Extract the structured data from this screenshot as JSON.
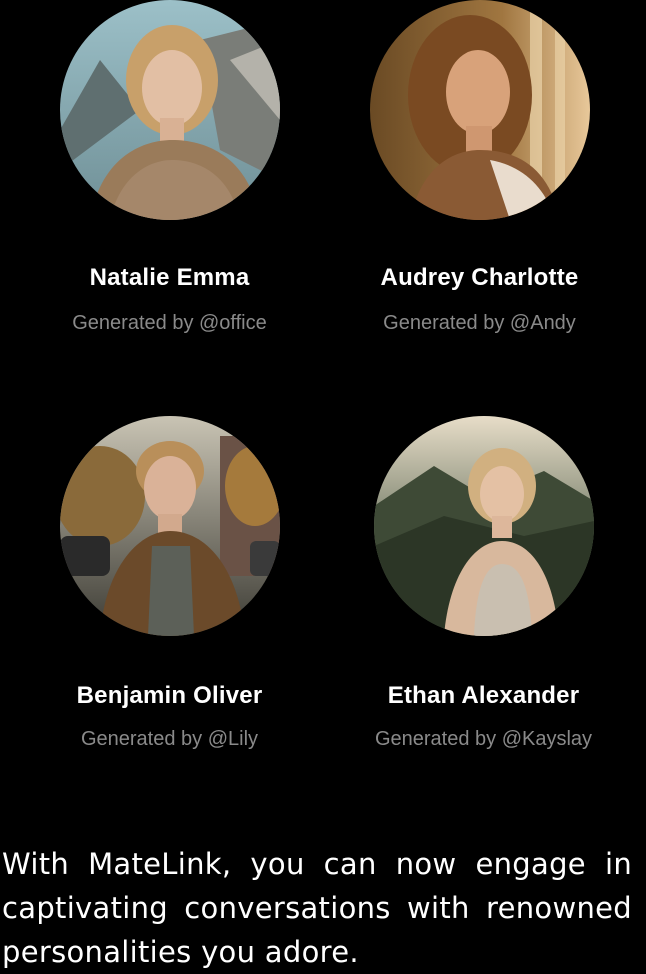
{
  "profiles": [
    {
      "name": "Natalie Emma",
      "credit": "Generated by @office",
      "avatar_icon": "portrait-woman-sweater"
    },
    {
      "name": "Audrey Charlotte",
      "credit": "Generated by @Andy",
      "avatar_icon": "portrait-woman-sunlight"
    },
    {
      "name": "Benjamin Oliver",
      "credit": "Generated by @Lily",
      "avatar_icon": "portrait-boy-street"
    },
    {
      "name": "Ethan Alexander",
      "credit": "Generated by @Kayslay",
      "avatar_icon": "portrait-woman-hills"
    }
  ],
  "tagline": "With MateLink, you can now engage in captivating conversations with renowned personalities you adore.",
  "colors": {
    "background": "#000000",
    "name_text": "#ffffff",
    "credit_text": "#8a8a8a"
  }
}
